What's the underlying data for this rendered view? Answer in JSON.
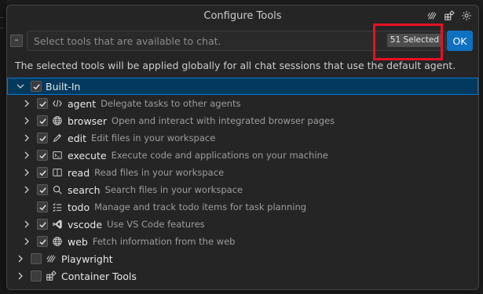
{
  "dialog": {
    "title": "Configure Tools",
    "search_placeholder": "Select tools that are available to chat.",
    "selected_count": "51 Selected",
    "ok_label": "OK",
    "collapse_label": "–",
    "description": "The selected tools will be applied globally for all chat sessions that use the default agent."
  },
  "groups": {
    "builtin": {
      "label": "Built-In",
      "tools": [
        {
          "name": "agent",
          "desc": "Delegate tasks to other agents",
          "icon": "code-agent-icon"
        },
        {
          "name": "browser",
          "desc": "Open and interact with integrated browser pages",
          "icon": "globe-icon"
        },
        {
          "name": "edit",
          "desc": "Edit files in your workspace",
          "icon": "pencil-icon"
        },
        {
          "name": "execute",
          "desc": "Execute code and applications on your machine",
          "icon": "terminal-icon"
        },
        {
          "name": "read",
          "desc": "Read files in your workspace",
          "icon": "book-icon"
        },
        {
          "name": "search",
          "desc": "Search files in your workspace",
          "icon": "search-icon"
        },
        {
          "name": "todo",
          "desc": "Manage and track todo items for task planning",
          "icon": "checklist-icon"
        },
        {
          "name": "vscode",
          "desc": "Use VS Code features",
          "icon": "vscode-icon"
        },
        {
          "name": "web",
          "desc": "Fetch information from the web",
          "icon": "globe-icon"
        }
      ]
    },
    "playwright": {
      "label": "Playwright"
    },
    "container": {
      "label": "Container Tools"
    }
  },
  "colors": {
    "accent": "#0e70c0",
    "highlight": "#e81123",
    "selection": "#04395e"
  }
}
